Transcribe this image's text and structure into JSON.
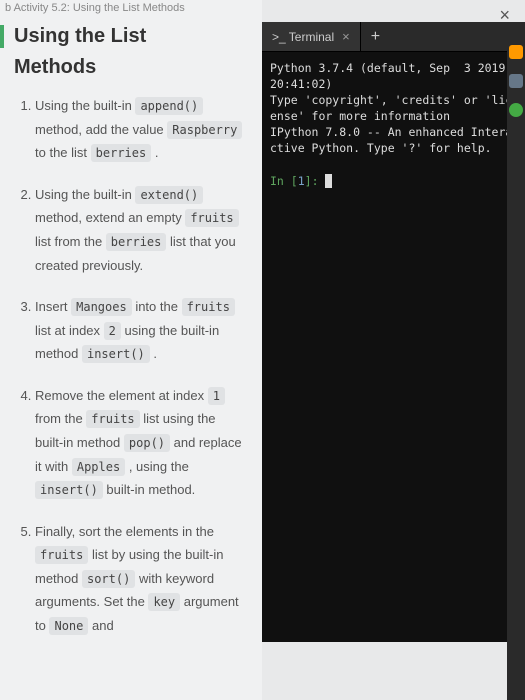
{
  "breadcrumb": "b Activity 5.2: Using the List Methods",
  "article": {
    "title_line1": "Using the List",
    "title_line2": "Methods",
    "steps": [
      {
        "parts": [
          {
            "t": "Using the built-in "
          },
          {
            "t": "append()",
            "code": true
          },
          {
            "t": " method, add the value "
          },
          {
            "t": "Raspberry",
            "code": true
          },
          {
            "t": " to the list "
          },
          {
            "t": "berries",
            "code": true
          },
          {
            "t": " ."
          }
        ]
      },
      {
        "parts": [
          {
            "t": "Using the built-in "
          },
          {
            "t": "extend()",
            "code": true
          },
          {
            "t": " method, extend an empty "
          },
          {
            "t": "fruits",
            "code": true
          },
          {
            "t": " list from the "
          },
          {
            "t": "berries",
            "code": true
          },
          {
            "t": " list that you created previously."
          }
        ]
      },
      {
        "parts": [
          {
            "t": "Insert "
          },
          {
            "t": "Mangoes",
            "code": true
          },
          {
            "t": " into the "
          },
          {
            "t": "fruits",
            "code": true
          },
          {
            "t": " list at index "
          },
          {
            "t": "2",
            "code": true
          },
          {
            "t": " using the built-in method "
          },
          {
            "t": "insert()",
            "code": true
          },
          {
            "t": " ."
          }
        ]
      },
      {
        "parts": [
          {
            "t": "Remove the element at index "
          },
          {
            "t": "1",
            "code": true
          },
          {
            "t": " from the "
          },
          {
            "t": "fruits",
            "code": true
          },
          {
            "t": " list using the built-in method "
          },
          {
            "t": "pop()",
            "code": true
          },
          {
            "t": " and replace it with "
          },
          {
            "t": "Apples",
            "code": true
          },
          {
            "t": " , using the "
          },
          {
            "t": "insert()",
            "code": true
          },
          {
            "t": " built-in method."
          }
        ]
      },
      {
        "parts": [
          {
            "t": "Finally, sort the elements in the "
          },
          {
            "t": "fruits",
            "code": true
          },
          {
            "t": " list by using the built-in method "
          },
          {
            "t": "sort()",
            "code": true
          },
          {
            "t": " with keyword arguments. Set the "
          },
          {
            "t": "key",
            "code": true
          },
          {
            "t": " argument to "
          },
          {
            "t": "None",
            "code": true
          },
          {
            "t": " and"
          }
        ]
      }
    ]
  },
  "terminal": {
    "tab_label": ">_ Terminal",
    "tab_close": "×",
    "tab_add": "+",
    "body_lines": [
      "Python 3.7.4 (default, Sep  3 2019, 20:41:02)",
      "Type 'copyright', 'credits' or 'license' for more information",
      "IPython 7.8.0 -- An enhanced Interactive Python. Type '?' for help.",
      ""
    ],
    "prompt_in": "In [",
    "prompt_num": "1",
    "prompt_close": "]: "
  },
  "close_icon": "×"
}
